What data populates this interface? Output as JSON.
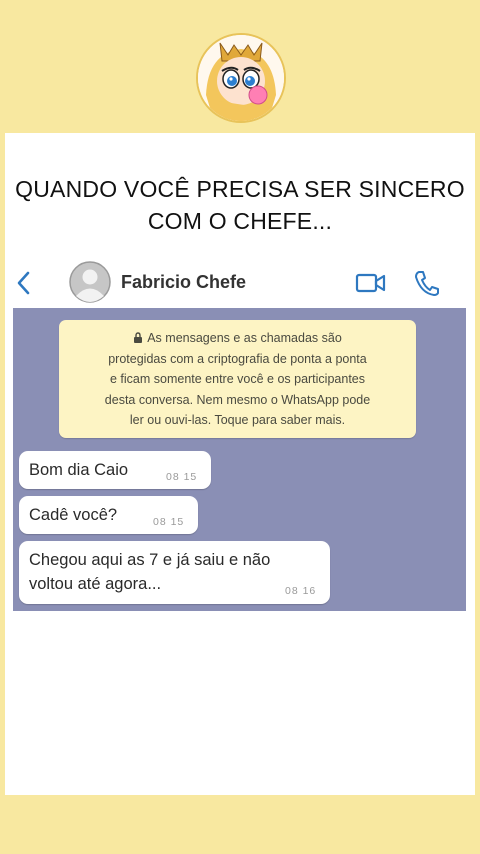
{
  "caption": {
    "line1": "QUANDO VOCÊ PRECISA SER SINCERO",
    "line2": "COM O CHEFE..."
  },
  "chat": {
    "contact_name": "Fabricio Chefe",
    "icons": [
      "back-arrow-icon",
      "contact-avatar-icon",
      "video-call-icon",
      "phone-call-icon"
    ],
    "encryption_notice": {
      "lines": [
        "As mensagens e as chamadas são",
        "protegidas com a criptografia de ponta a ponta",
        "e ficam somente entre você e os participantes",
        "desta conversa. Nem mesmo o WhatsApp pode",
        "ler ou ouvi-las. Toque para saber mais."
      ]
    },
    "messages": [
      {
        "lines": [
          "Bom dia Caio"
        ],
        "time": "08 15"
      },
      {
        "lines": [
          "Cadê você?"
        ],
        "time": "08 15"
      },
      {
        "lines": [
          "Chegou aqui as 7 e já saiu e não",
          "voltou até agora..."
        ],
        "time": "08 16"
      }
    ]
  },
  "colors": {
    "page_background": "#f8e8a0",
    "chat_background": "#8a8fb5",
    "notice_background": "#fdf4c4",
    "accent_blue": "#2e78c0"
  }
}
